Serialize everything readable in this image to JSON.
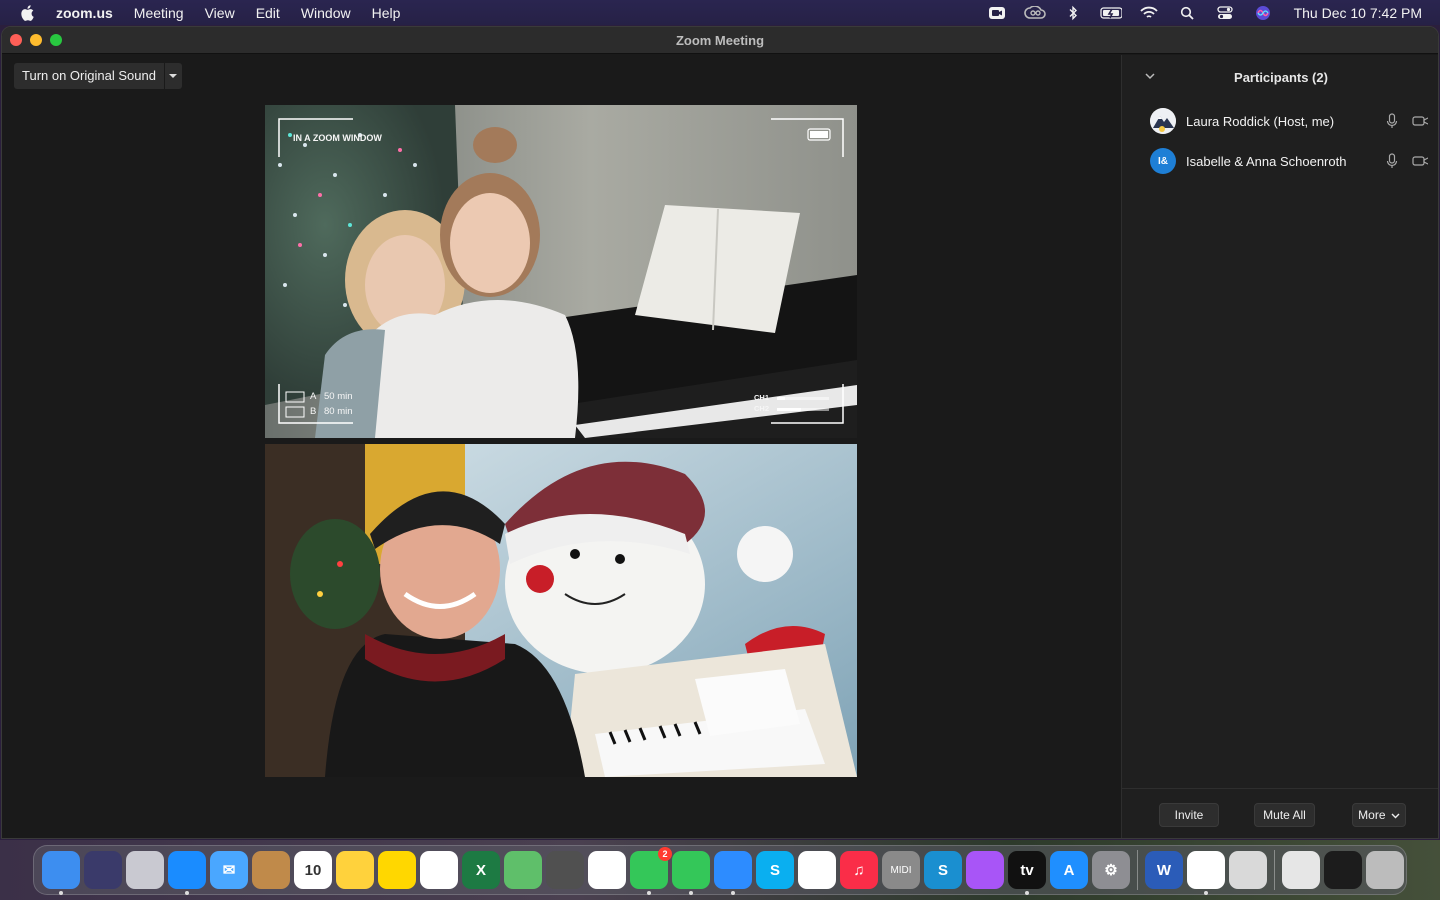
{
  "menubar": {
    "app_name": "zoom.us",
    "menus": [
      "Meeting",
      "View",
      "Edit",
      "Window",
      "Help"
    ],
    "clock": "Thu Dec 10  7:42 PM",
    "status_icons": [
      "zoom-camera-icon",
      "creative-cloud-icon",
      "bluetooth-icon",
      "battery-icon",
      "wifi-icon",
      "spotlight-icon",
      "control-center-icon",
      "siri-icon"
    ]
  },
  "window": {
    "title": "Zoom Meeting"
  },
  "meeting": {
    "original_sound_label": "Turn on Original Sound",
    "video1_overlay": {
      "label": "IN A ZOOM WINDOW",
      "a_label": "A",
      "a_value": "50 min",
      "b_label": "B",
      "b_value": "80 min",
      "ch1": "CH1",
      "ch2": "CH2"
    }
  },
  "participants": {
    "title": "Participants (2)",
    "list": [
      {
        "name": "Laura Roddick (Host, me)",
        "initials": ""
      },
      {
        "name": "Isabelle & Anna Schoenroth",
        "initials": "I&"
      }
    ],
    "invite_label": "Invite",
    "mute_all_label": "Mute All",
    "more_label": "More"
  },
  "dock": {
    "apps": [
      {
        "name": "finder-icon",
        "color": "#3d8ef0",
        "glyph": "",
        "running": true
      },
      {
        "name": "siri-app-icon",
        "color": "#3a3a6a",
        "glyph": "",
        "running": false
      },
      {
        "name": "launchpad-icon",
        "color": "#c9c9d1",
        "glyph": "",
        "running": false
      },
      {
        "name": "safari-icon",
        "color": "#1a8cff",
        "glyph": "",
        "running": true
      },
      {
        "name": "mail-icon",
        "color": "#4aa7ff",
        "glyph": "✉",
        "running": false
      },
      {
        "name": "contacts-icon",
        "color": "#c08a4a",
        "glyph": "",
        "running": false
      },
      {
        "name": "calendar-icon",
        "color": "#ffffff",
        "glyph": "10",
        "running": false
      },
      {
        "name": "notes-icon",
        "color": "#ffd23c",
        "glyph": "",
        "running": false
      },
      {
        "name": "stickies-icon",
        "color": "#ffd700",
        "glyph": "",
        "running": false
      },
      {
        "name": "reminders-icon",
        "color": "#ffffff",
        "glyph": "",
        "running": false
      },
      {
        "name": "excel-icon",
        "color": "#1d7a43",
        "glyph": "X",
        "running": false
      },
      {
        "name": "maps-icon",
        "color": "#5fbf6a",
        "glyph": "",
        "running": false
      },
      {
        "name": "calculator-icon",
        "color": "#505050",
        "glyph": "",
        "running": false
      },
      {
        "name": "photos-icon",
        "color": "#ffffff",
        "glyph": "",
        "running": false
      },
      {
        "name": "messages-icon",
        "color": "#34c759",
        "glyph": "",
        "running": true,
        "badge": "2"
      },
      {
        "name": "facetime-icon",
        "color": "#34c759",
        "glyph": "",
        "running": true
      },
      {
        "name": "zoom-icon",
        "color": "#2d8cff",
        "glyph": "",
        "running": true
      },
      {
        "name": "skype-icon",
        "color": "#0aaff0",
        "glyph": "S",
        "running": false
      },
      {
        "name": "news-icon",
        "color": "#ffffff",
        "glyph": "",
        "running": false
      },
      {
        "name": "music-icon",
        "color": "#fa2d48",
        "glyph": "♫",
        "running": false
      },
      {
        "name": "midi-icon",
        "color": "#8a8a8a",
        "glyph": "MIDI",
        "running": false
      },
      {
        "name": "simplenote-icon",
        "color": "#1a8fd0",
        "glyph": "S",
        "running": false
      },
      {
        "name": "podcasts-icon",
        "color": "#a855f7",
        "glyph": "",
        "running": false
      },
      {
        "name": "appletv-icon",
        "color": "#111111",
        "glyph": "tv",
        "running": true
      },
      {
        "name": "appstore-icon",
        "color": "#1f8fff",
        "glyph": "A",
        "running": false
      },
      {
        "name": "system-preferences-icon",
        "color": "#8e8e93",
        "glyph": "⚙",
        "running": false
      },
      {
        "name": "word-icon",
        "color": "#2b5cb8",
        "glyph": "W",
        "running": false
      },
      {
        "name": "chrome-icon",
        "color": "#ffffff",
        "glyph": "",
        "running": true
      },
      {
        "name": "preview-icon",
        "color": "#d9d9d9",
        "glyph": "",
        "running": false
      },
      {
        "name": "downloads-stack-icon",
        "color": "#e6e6e6",
        "glyph": "",
        "running": false
      },
      {
        "name": "recent-window-icon",
        "color": "#1c1c1c",
        "glyph": "",
        "running": false
      },
      {
        "name": "trash-icon",
        "color": "#bcbcbc",
        "glyph": "",
        "running": false
      }
    ]
  }
}
